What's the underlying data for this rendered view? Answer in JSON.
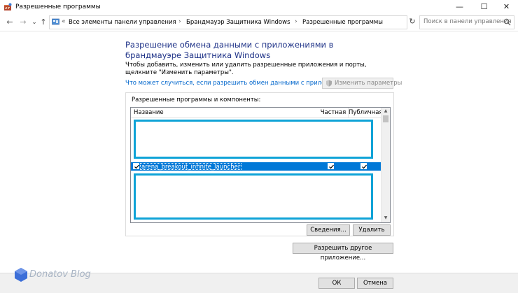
{
  "window": {
    "title": "Разрешенные программы",
    "minimize": "—",
    "maximize": "☐",
    "close": "✕"
  },
  "addressbar": {
    "back": "←",
    "forward": "→",
    "dropdown": "⌄",
    "up": "↑",
    "overflow": "«",
    "separator": "›",
    "crumbs": [
      "Все элементы панели управления",
      "Брандмауэр Защитника Windows",
      "Разрешенные программы"
    ],
    "refresh": "↻",
    "search_placeholder": "Поиск в панели управления"
  },
  "main": {
    "heading": "Разрешение обмена данными с приложениями в брандмауэре Защитника Windows",
    "description": "Чтобы добавить, изменить или удалить разрешенные приложения и порты, щелкните \"Изменить параметры\".",
    "risk_link": "Что может случиться, если разрешить обмен данными с приложением?",
    "change_settings": "Изменить параметры",
    "group_label": "Разрешенные программы и компоненты:",
    "columns": {
      "name": "Название",
      "private": "Частная",
      "public": "Публичная"
    },
    "rows": [
      {
        "name": "arena_breakout_infinite_launcher",
        "enabled": true,
        "private": true,
        "public": true
      }
    ],
    "details_button": "Сведения...",
    "remove_button": "Удалить",
    "allow_other_button": "Разрешить другое приложение..."
  },
  "footer": {
    "ok": "ОК",
    "cancel": "Отмена"
  },
  "watermark": {
    "text": "Donatov Blog"
  },
  "colors": {
    "accent": "#0078d7",
    "heading": "#1e3287",
    "link": "#0066cc",
    "redaction": "#0fa3d7"
  }
}
